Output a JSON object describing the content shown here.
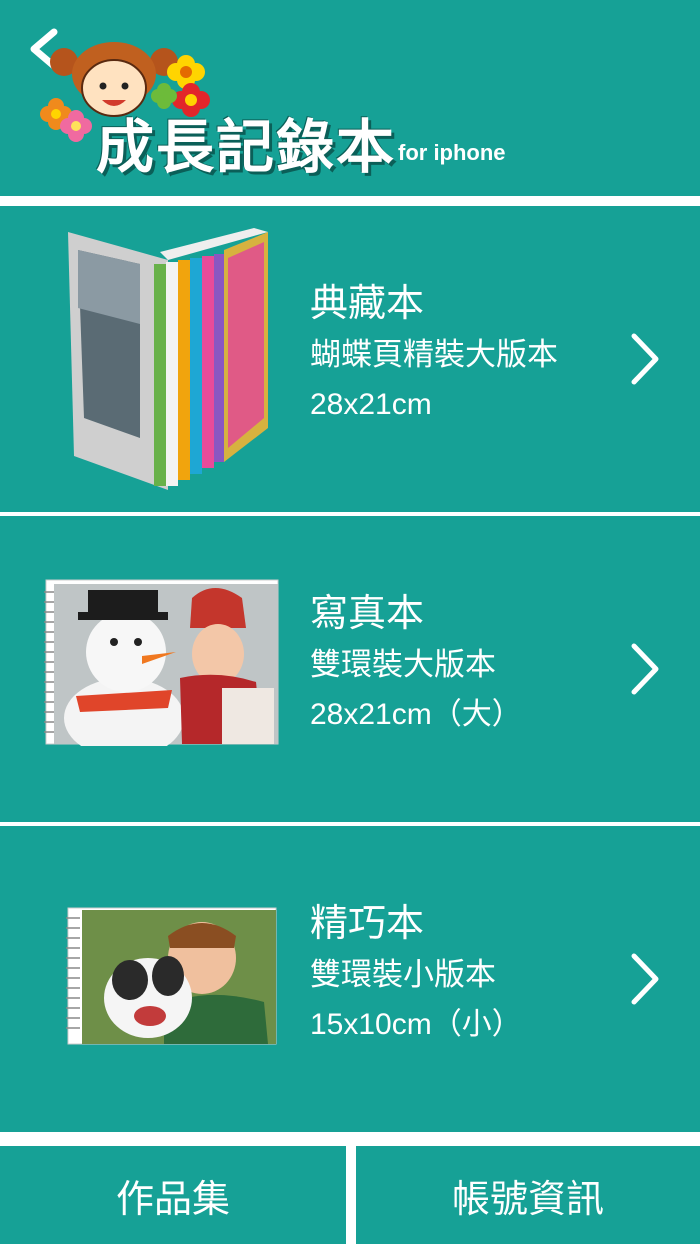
{
  "header": {
    "title": "成長記錄本",
    "subtitle": "for iphone"
  },
  "products": [
    {
      "name": "典藏本",
      "description": "蝴蝶頁精裝大版本",
      "size": "28x21cm"
    },
    {
      "name": "寫真本",
      "description": "雙環裝大版本",
      "size": "28x21cm（大）"
    },
    {
      "name": "精巧本",
      "description": "雙環裝小版本",
      "size": "15x10cm（小）"
    }
  ],
  "bottom_nav": {
    "portfolio_label": "作品集",
    "account_label": "帳號資訊"
  },
  "colors": {
    "primary": "#16a196",
    "divider": "#ffffff"
  }
}
